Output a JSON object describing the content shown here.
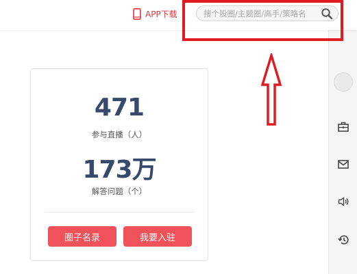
{
  "header": {
    "app_download_label": "APP下载",
    "search": {
      "placeholder": "搜个股圈/主题圈/高手/策略名"
    }
  },
  "stats": {
    "participants": {
      "value": "471",
      "label": "参与直播（人）"
    },
    "answers": {
      "value": "173万",
      "label": "解答问题（个）"
    }
  },
  "buttons": {
    "directory": "圈子名录",
    "join": "我要入驻"
  },
  "colors": {
    "accent_red": "#f0525a",
    "number_navy": "#374a6b",
    "annotation_red": "#e01b24"
  },
  "side_rail": {
    "icons": [
      "avatar",
      "briefcase-icon",
      "mail-icon",
      "speaker-icon",
      "history-icon"
    ]
  }
}
